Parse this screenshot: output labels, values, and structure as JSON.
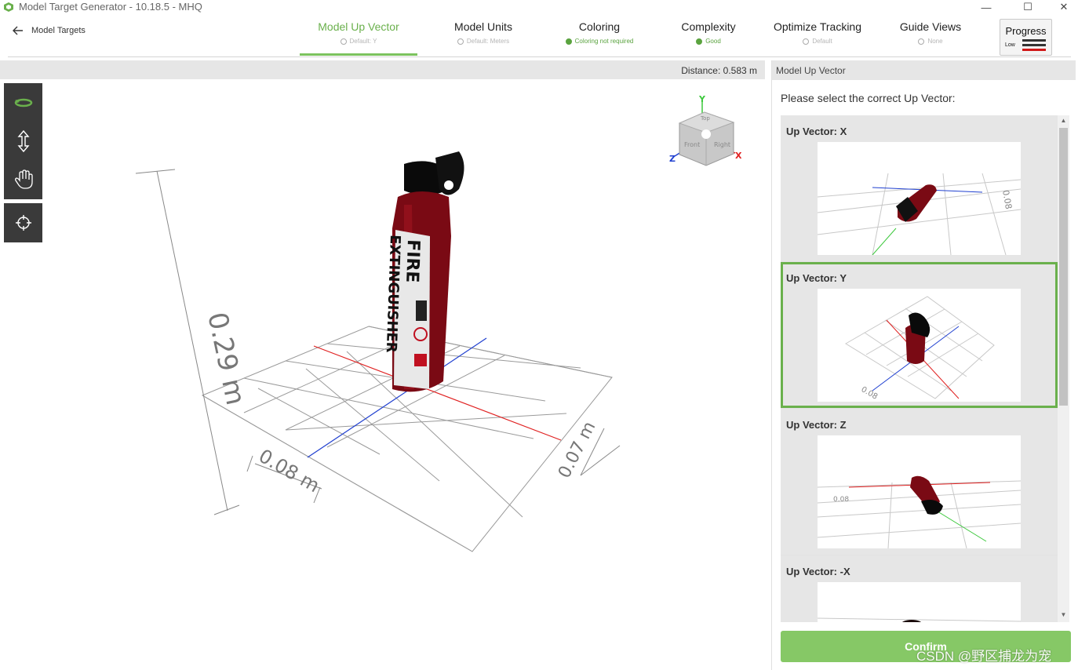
{
  "window": {
    "title": "Model Target Generator - 10.18.5 - MHQ",
    "controls": [
      "—",
      "☐",
      "✕"
    ]
  },
  "nav": {
    "back_label": "Model Targets",
    "steps": [
      {
        "label": "Model Up Vector",
        "sub": "Default: Y"
      },
      {
        "label": "Model Units",
        "sub": "Default: Meters"
      },
      {
        "label": "Coloring",
        "sub": "Coloring not required"
      },
      {
        "label": "Complexity",
        "sub": "Good"
      },
      {
        "label": "Optimize Tracking",
        "sub": "Default"
      },
      {
        "label": "Guide Views",
        "sub": "None"
      }
    ],
    "progress": {
      "label": "Progress",
      "level": "Low"
    }
  },
  "viewport": {
    "distance_label": "Distance:",
    "distance_value": "0.583 m",
    "measure_height": "0.29 m",
    "measure_width": "0.08 m",
    "measure_depth": "0.07 m",
    "gizmo": {
      "y": "Y",
      "z": "Z",
      "x": "X",
      "faces": [
        "Top",
        "Front",
        "Right"
      ]
    },
    "product_text": [
      "FIRE",
      "EXTINGUISHER"
    ],
    "tools": [
      "orbit-icon",
      "zoom-icon",
      "pan-icon",
      "focus-icon"
    ]
  },
  "panel": {
    "header": "Model Up Vector",
    "prompt": "Please select the correct Up Vector:",
    "options": [
      {
        "title": "Up Vector: X",
        "thumb_label": "0.08"
      },
      {
        "title": "Up Vector: Y",
        "thumb_label": "0.08"
      },
      {
        "title": "Up Vector: Z",
        "thumb_label": "0.08"
      },
      {
        "title": "Up Vector: -X",
        "thumb_label": ""
      }
    ],
    "selected_index": 1,
    "confirm_label": "Confirm"
  },
  "watermark": "CSDN @野区捕龙为宠",
  "colors": {
    "accent": "#6ab04c",
    "confirm": "#86c866",
    "axis_red": "#e02020",
    "axis_blue": "#2040d0",
    "axis_green": "#3cc83c"
  }
}
